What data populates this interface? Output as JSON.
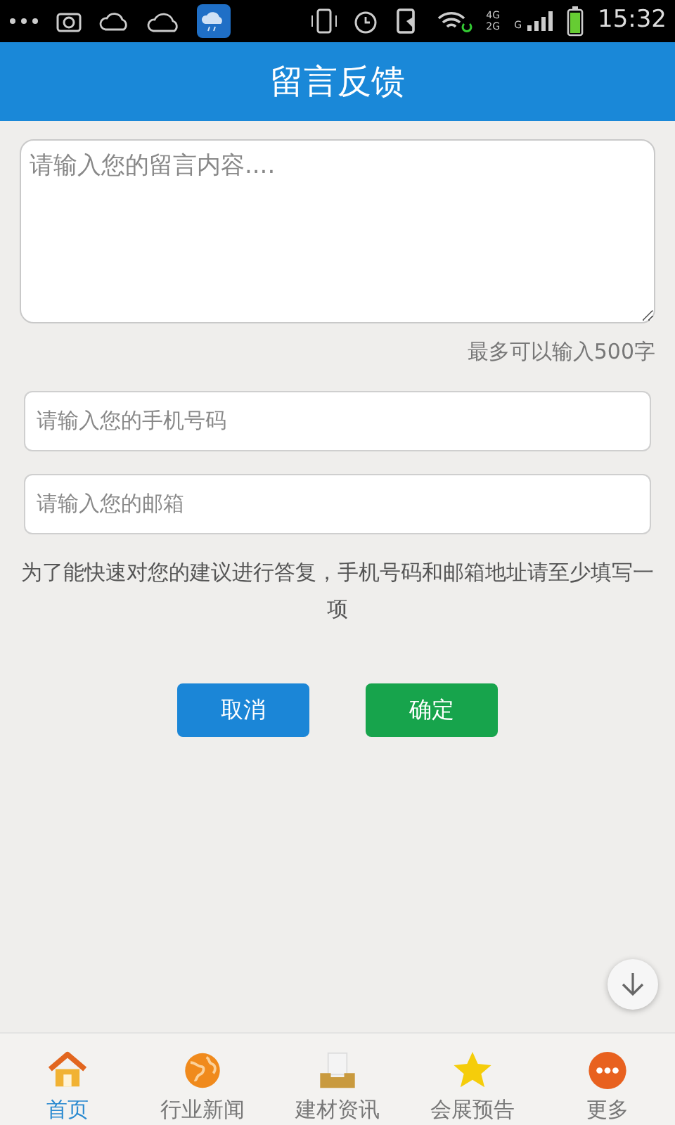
{
  "status_bar": {
    "network_top": "4G",
    "network_bottom": "2G",
    "signal_label": "G",
    "time": "15:32"
  },
  "header": {
    "title": "留言反馈"
  },
  "form": {
    "message_placeholder": "请输入您的留言内容....",
    "limit_hint": "最多可以输入500字",
    "phone_placeholder": "请输入您的手机号码",
    "email_placeholder": "请输入您的邮箱",
    "note": "为了能快速对您的建议进行答复，手机号码和邮箱地址请至少填写一项"
  },
  "buttons": [
    {
      "label": "取消",
      "kind": "cancel"
    },
    {
      "label": "确定",
      "kind": "confirm"
    }
  ],
  "bottom_nav": [
    {
      "label": "首页",
      "selected": true
    },
    {
      "label": "行业新闻",
      "selected": false
    },
    {
      "label": "建材资讯",
      "selected": false
    },
    {
      "label": "会展预告",
      "selected": false
    },
    {
      "label": "更多",
      "selected": false
    }
  ]
}
